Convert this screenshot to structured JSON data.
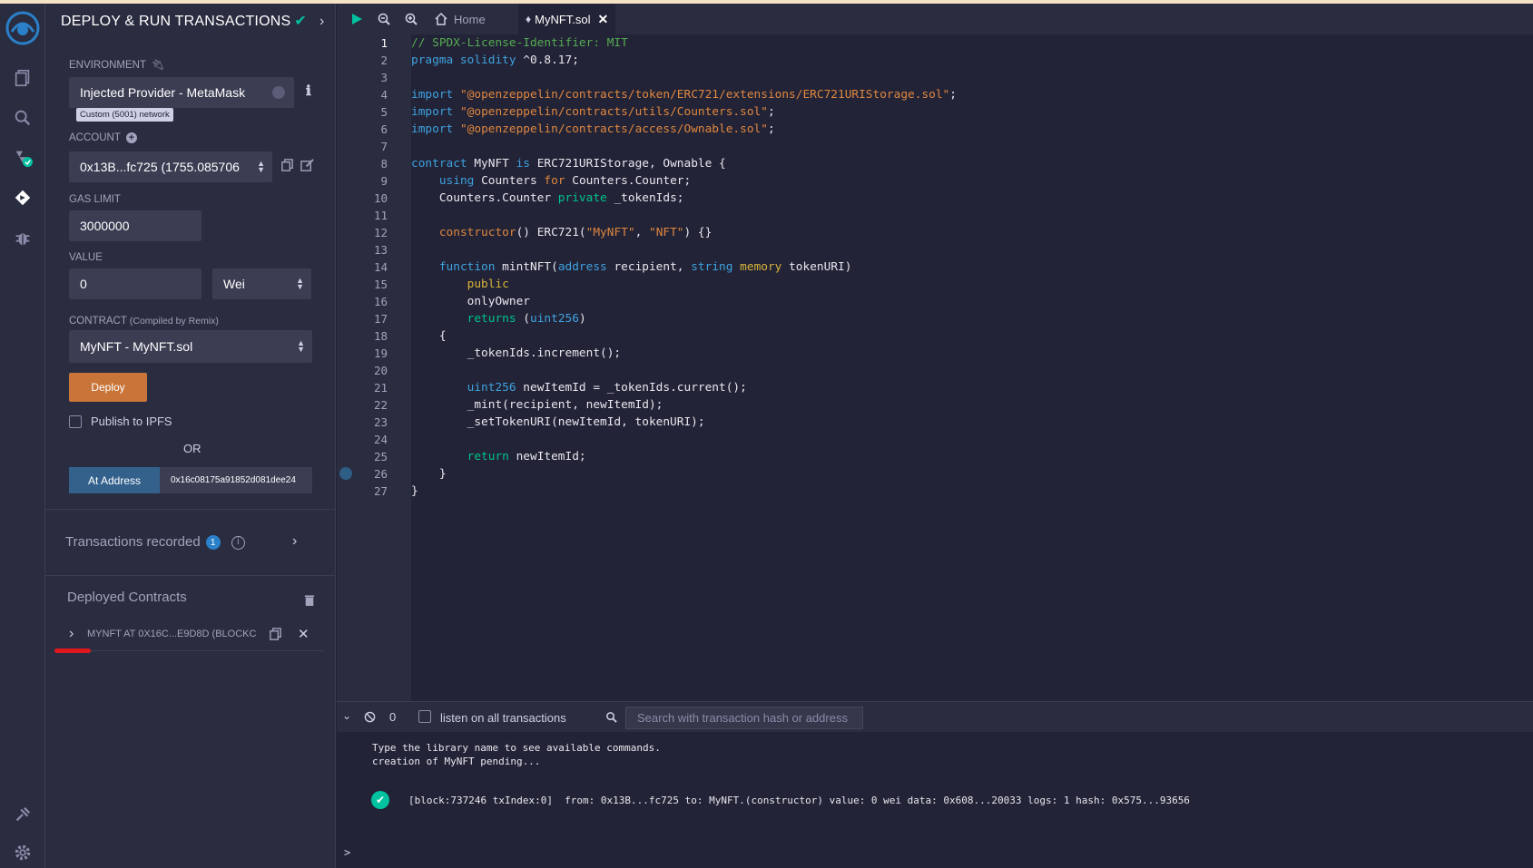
{
  "plugin_panel": {
    "title": "DEPLOY & RUN TRANSACTIONS",
    "environment": {
      "label": "ENVIRONMENT",
      "value": "Injected Provider - MetaMask",
      "network_badge": "Custom (5001) network"
    },
    "account": {
      "label": "ACCOUNT",
      "value": "0x13B...fc725 (1755.085706"
    },
    "gas_limit": {
      "label": "GAS LIMIT",
      "value": "3000000"
    },
    "value": {
      "label": "VALUE",
      "amount": "0",
      "unit": "Wei"
    },
    "contract": {
      "label": "CONTRACT",
      "sub_label": "(Compiled by Remix)",
      "value": "MyNFT - MyNFT.sol"
    },
    "deploy_label": "Deploy",
    "publish_ipfs_label": "Publish to IPFS",
    "or_label": "OR",
    "at_address": {
      "button_label": "At Address",
      "input_value": "0x16c08175a91852d081dee24"
    },
    "transactions_recorded": {
      "label": "Transactions recorded",
      "count": "1"
    },
    "deployed_contracts": {
      "label": "Deployed Contracts",
      "instance_label": "MYNFT AT 0X16C...E9D8D (BLOCKCH"
    }
  },
  "editor": {
    "tabs": [
      {
        "label": "Home"
      },
      {
        "label": "MyNFT.sol"
      }
    ],
    "line_numbers": [
      "1",
      "2",
      "3",
      "4",
      "5",
      "6",
      "7",
      "8",
      "9",
      "10",
      "11",
      "12",
      "13",
      "14",
      "15",
      "16",
      "17",
      "18",
      "19",
      "20",
      "21",
      "22",
      "23",
      "24",
      "25",
      "26",
      "27"
    ]
  },
  "terminal": {
    "pending_count": "0",
    "listen_label": "listen on all transactions",
    "search_placeholder": "Search with transaction hash or address",
    "line1": "Type the library name to see available commands.",
    "line2": "creation of MyNFT pending...",
    "tx_log": "[block:737246 txIndex:0]  from: 0x13B...fc725 to: MyNFT.(constructor) value: 0 wei data: 0x608...20033 logs: 1 hash: 0x575...93656",
    "prompt": ">"
  }
}
